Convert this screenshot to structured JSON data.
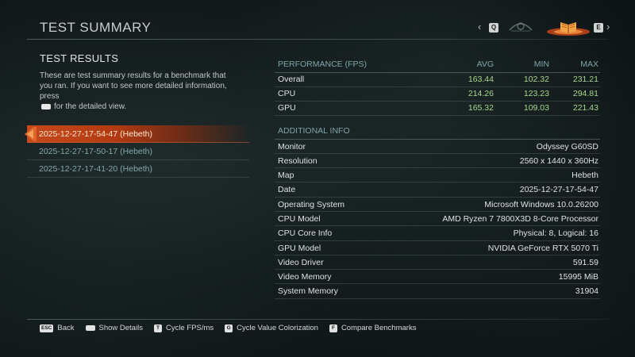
{
  "header": {
    "title": "TEST SUMMARY",
    "nav_left_key": "Q",
    "nav_right_key": "E"
  },
  "left": {
    "section_title": "TEST RESULTS",
    "desc_part1": "These are test summary results for a benchmark that you ran. If you want to see more detailed information, press",
    "desc_part2": "for the detailed view.",
    "results": [
      "2025-12-27-17-54-47 (Hebeth)",
      "2025-12-27-17-50-17 (Hebeth)",
      "2025-12-27-17-41-20 (Hebeth)"
    ],
    "selected_index": 0
  },
  "performance": {
    "header": [
      "PERFORMANCE (FPS)",
      "AVG",
      "MIN",
      "MAX"
    ],
    "rows": [
      [
        "Overall",
        "163.44",
        "102.32",
        "231.21"
      ],
      [
        "CPU",
        "214.26",
        "123.23",
        "294.81"
      ],
      [
        "GPU",
        "165.32",
        "109.03",
        "221.43"
      ]
    ]
  },
  "additional": {
    "title": "ADDITIONAL INFO",
    "rows": [
      [
        "Monitor",
        "Odyssey G60SD"
      ],
      [
        "Resolution",
        "2560 x 1440 x 360Hz"
      ],
      [
        "Map",
        "Hebeth"
      ],
      [
        "Date",
        "2025-12-27-17-54-47"
      ],
      [
        "Operating System",
        "Microsoft Windows 10.0.26200"
      ],
      [
        "CPU Model",
        "AMD Ryzen 7 7800X3D 8-Core Processor"
      ],
      [
        "CPU Core Info",
        "Physical: 8, Logical: 16"
      ],
      [
        "GPU Model",
        "NVIDIA GeForce RTX 5070 Ti"
      ],
      [
        "Video Driver",
        "591.59"
      ],
      [
        "Video Memory",
        "15995 MiB"
      ],
      [
        "System Memory",
        "31904"
      ]
    ]
  },
  "footer": {
    "hints": [
      {
        "key": "ESC",
        "label": "Back",
        "icon": "esc-key-icon"
      },
      {
        "key": "",
        "label": "Show Details",
        "icon": "spacebar-key-icon"
      },
      {
        "key": "T",
        "label": "Cycle FPS/ms",
        "icon": "t-key-icon"
      },
      {
        "key": "G",
        "label": "Cycle Value Colorization",
        "icon": "g-key-icon"
      },
      {
        "key": "F",
        "label": "Compare Benchmarks",
        "icon": "f-key-icon"
      }
    ]
  },
  "colors": {
    "accent_orange": "#c6481b",
    "value_green": "#a6d98c",
    "header_teal": "#7fa6a9"
  }
}
